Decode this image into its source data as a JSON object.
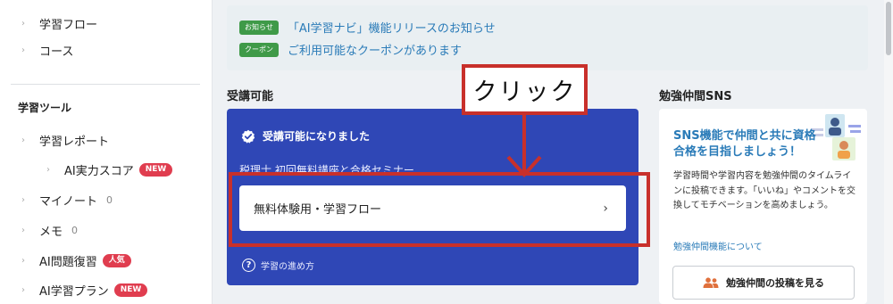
{
  "sidebar": {
    "items": [
      {
        "label": "学習フロー"
      },
      {
        "label": "コース"
      }
    ],
    "heading": "学習ツール",
    "tools": [
      {
        "label": "学習レポート"
      },
      {
        "label": "AI実力スコア",
        "badge": "NEW"
      },
      {
        "label": "マイノート",
        "count": "0"
      },
      {
        "label": "メモ",
        "count": "0"
      },
      {
        "label": "AI問題復習",
        "badge": "人気"
      },
      {
        "label": "AI学習プラン",
        "badge": "NEW"
      }
    ]
  },
  "notices": [
    {
      "tag": "お知らせ",
      "text": "「AI学習ナビ」機能リリースのお知らせ"
    },
    {
      "tag": "クーポン",
      "text": "ご利用可能なクーポンがあります"
    }
  ],
  "main": {
    "section_title": "受講可能",
    "card": {
      "status": "受講可能になりました",
      "course_name": "税理士 初回無料講座と合格セミナー",
      "button_label": "無料体験用・学習フロー",
      "chevron": "›",
      "help_label": "学習の進め方",
      "help_glyph": "?"
    }
  },
  "annotation": {
    "label": "クリック",
    "color": "#c8302b"
  },
  "sns": {
    "section_title": "勉強仲間SNS",
    "headline": "SNS機能で仲間と共に資格合格を目指しましょう！",
    "description": "学習時間や学習内容を勉強仲間のタイムラインに投稿できます。「いいね」やコメントを交換してモチベーションを高めましょう。",
    "link": "勉強仲間機能について",
    "button_label": "勉強仲間の投稿を見る"
  },
  "colors": {
    "card_blue": "#2f47b6",
    "link_blue": "#2a7bb8",
    "tag_green": "#3f9a48",
    "badge_red": "#e03d4f"
  }
}
